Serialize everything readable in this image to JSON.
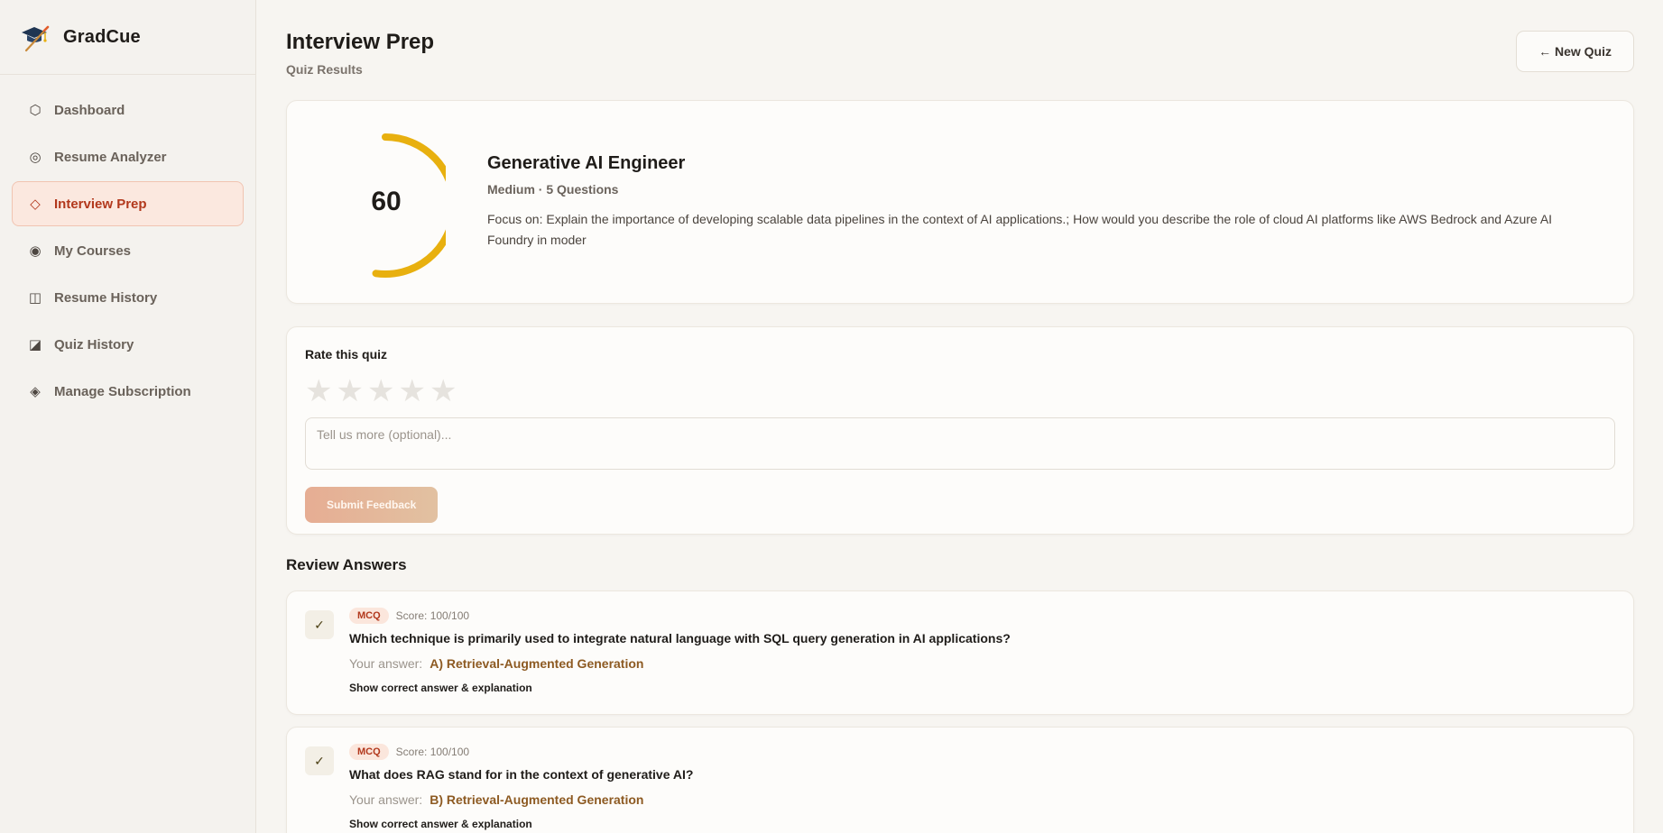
{
  "brand": {
    "name": "GradCue",
    "logo_icon": "graduation-cap-icon"
  },
  "sidebar": {
    "items": [
      {
        "label": "Dashboard",
        "icon": "⬡",
        "icon_name": "hexagon-icon",
        "active": false
      },
      {
        "label": "Resume Analyzer",
        "icon": "◎",
        "icon_name": "target-icon",
        "active": false
      },
      {
        "label": "Interview Prep",
        "icon": "◇",
        "icon_name": "diamond-icon",
        "active": true
      },
      {
        "label": "My Courses",
        "icon": "◉",
        "icon_name": "circle-dot-icon",
        "active": false
      },
      {
        "label": "Resume History",
        "icon": "◫",
        "icon_name": "columns-icon",
        "active": false
      },
      {
        "label": "Quiz History",
        "icon": "◪",
        "icon_name": "square-half-icon",
        "active": false
      },
      {
        "label": "Manage Subscription",
        "icon": "◈",
        "icon_name": "diamond-filled-icon",
        "active": false
      }
    ]
  },
  "header": {
    "title": "Interview Prep",
    "subtitle": "Quiz Results",
    "new_quiz_label": "← New Quiz"
  },
  "score": {
    "value": "60",
    "fraction": 0.6,
    "color": "#e8b00f",
    "role": "Generative AI Engineer",
    "meta": "Medium · 5 Questions",
    "focus": "Focus on: Explain the importance of developing scalable data pipelines in the context of AI applications.; How would you describe the role of cloud AI platforms like AWS Bedrock and Azure AI Foundry in moder"
  },
  "rating": {
    "title": "Rate this quiz",
    "stars": 5,
    "selected": 0,
    "placeholder": "Tell us more (optional)...",
    "submit_label": "Submit Feedback"
  },
  "review": {
    "title": "Review Answers",
    "answer_label": "Your answer:",
    "show_label": "Show correct answer & explanation",
    "items": [
      {
        "type": "MCQ",
        "score": "Score: 100/100",
        "question": "Which technique is primarily used to integrate natural language with SQL query generation in AI applications?",
        "answer": "A) Retrieval-Augmented Generation"
      },
      {
        "type": "MCQ",
        "score": "Score: 100/100",
        "question": "What does RAG stand for in the context of generative AI?",
        "answer": "B) Retrieval-Augmented Generation"
      }
    ]
  }
}
